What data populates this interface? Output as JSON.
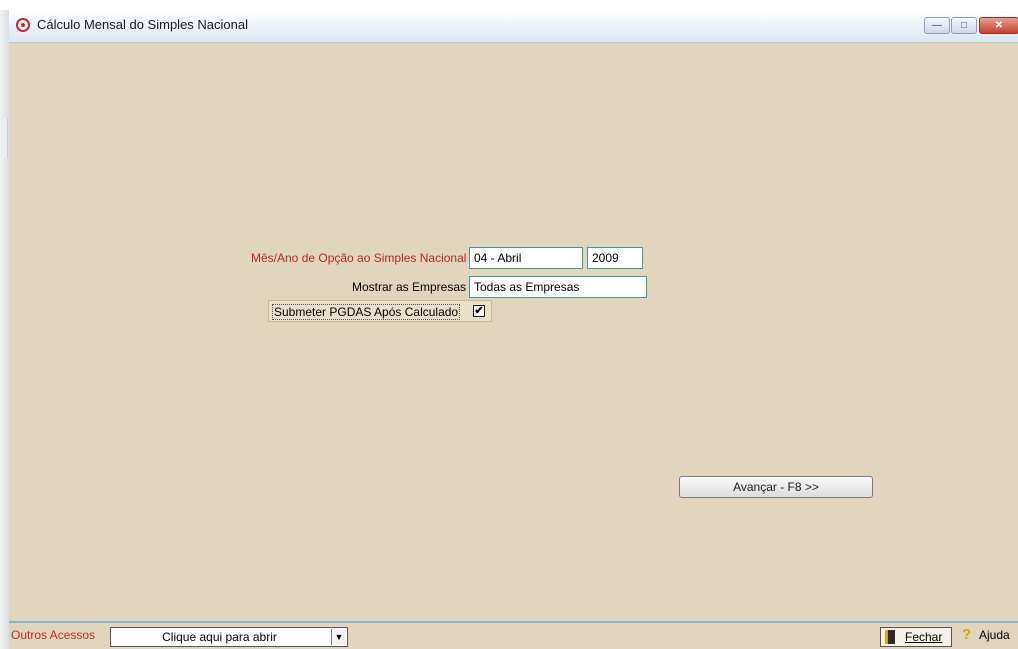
{
  "window": {
    "title": "Cálculo Mensal do Simples Nacional",
    "controls": {
      "minimize": "—",
      "maximize": "□",
      "close": "✕"
    }
  },
  "form": {
    "opcao_label": "Mês/Ano de Opção ao Simples Nacional",
    "opcao_month": "04 - Abril",
    "opcao_year": "2009",
    "mostrar_label": "Mostrar as Empresas",
    "mostrar_value": "Todas as Empresas",
    "submeter_label": "Submeter PGDAS Após Calculado",
    "submeter_checked": true,
    "check_mark": "✔"
  },
  "actions": {
    "avancar_label": "Avançar - F8 >>"
  },
  "bottom": {
    "outros_label": "Outros Acessos",
    "combo_value": "Clique aqui para abrir",
    "combo_arrow": "▼",
    "fechar_label": "Fechar",
    "ajuda_icon": "?",
    "ajuda_label": "Ajuda"
  },
  "colors": {
    "window_bg": "#e1d6bd",
    "required_label": "#b3262a",
    "field_border": "#3e9a8b"
  }
}
